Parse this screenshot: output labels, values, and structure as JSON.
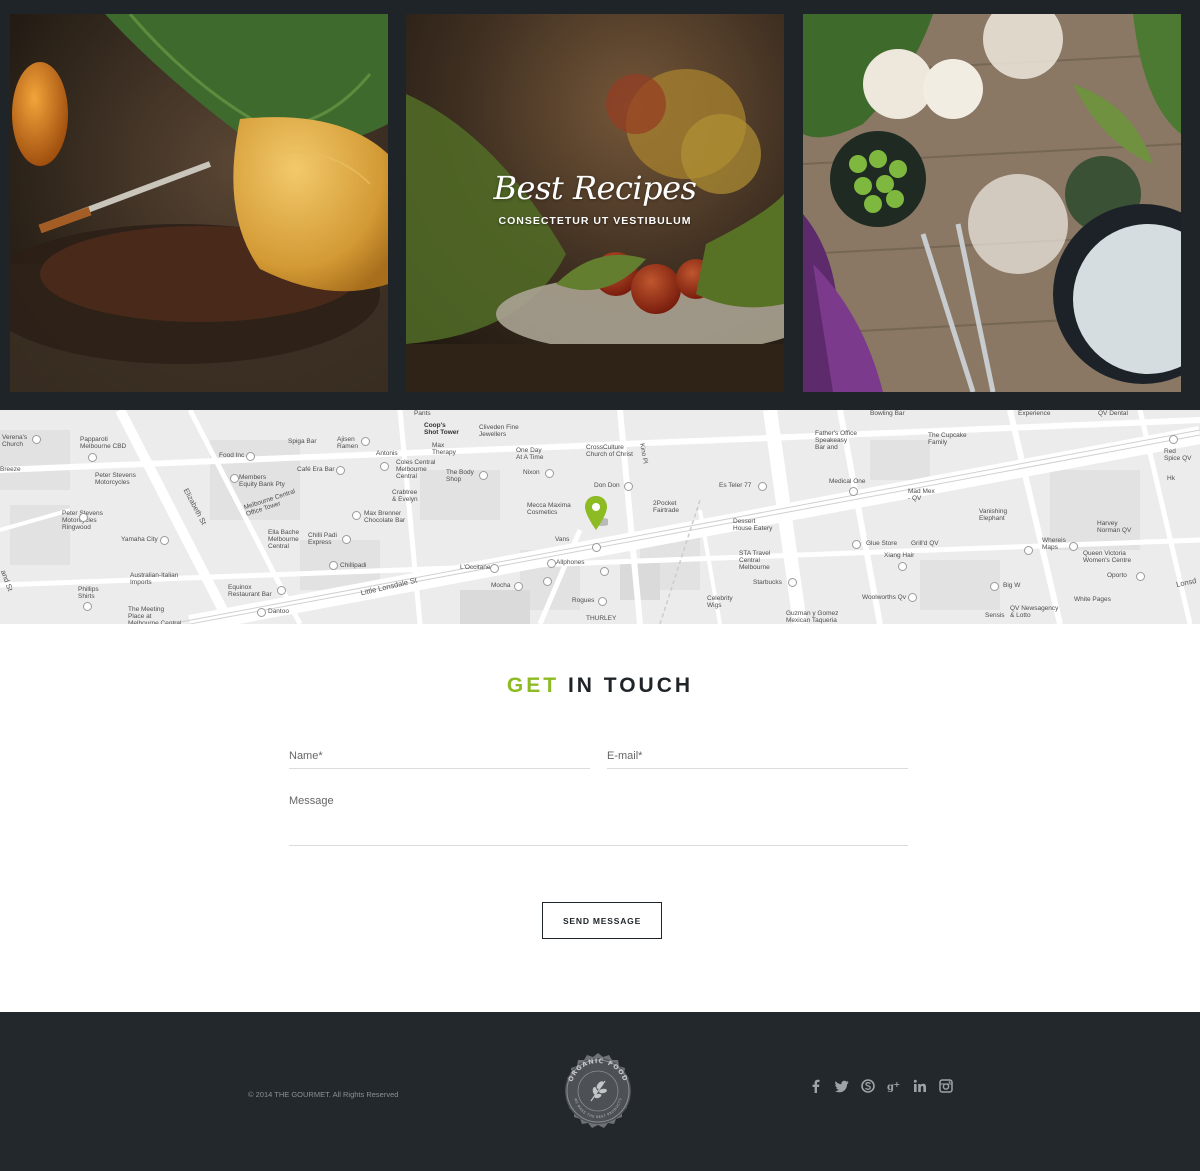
{
  "gallery": {
    "tiles": [
      {
        "name": "dessert-plate-photo"
      },
      {
        "name": "tomato-basil-photo",
        "title": "Best Recipes",
        "subtitle": "CONSECTETUR UT VESTIBULUM"
      },
      {
        "name": "table-setting-photo"
      }
    ]
  },
  "map": {
    "labels": [
      {
        "text": "Verena's\nChurch"
      },
      {
        "text": "Papparoti\nMelbourne CBD"
      },
      {
        "text": "Breeze"
      },
      {
        "text": "Peter Stevens\nMotorcycles"
      },
      {
        "text": "Peter Stevens\nMotorcycles\nRingwood"
      },
      {
        "text": "Yamaha City"
      },
      {
        "text": "Australian-Italian\nImports"
      },
      {
        "text": "Phillips\nShirts"
      },
      {
        "text": "The Meeting\nPlace at\nMelbourne Central"
      },
      {
        "text": "Food Inc"
      },
      {
        "text": "Members\nEquity Bank Pty"
      },
      {
        "text": "Melbourne Central\nOffice Tower"
      },
      {
        "text": "Ella Bache\nMelbourne\nCentral"
      },
      {
        "text": "Equinox\nRestaurant Bar"
      },
      {
        "text": "Dantoo"
      },
      {
        "text": "Spiga Bar"
      },
      {
        "text": "Café Era Bar"
      },
      {
        "text": "Ajisen\nRamen"
      },
      {
        "text": "Antonis"
      },
      {
        "text": "Chilli Padi\nExpress"
      },
      {
        "text": "Chillipadi"
      },
      {
        "text": "Max Brenner\nChocolate Bar"
      },
      {
        "text": "Coles Central\nMelbourne\nCentral"
      },
      {
        "text": "Crabtree\n& Evelyn"
      },
      {
        "text": "Max\nTherapy"
      },
      {
        "text": "Coop's\nShot Tower",
        "bold": true
      },
      {
        "text": "Cliveden Fine\nJewellers"
      },
      {
        "text": "The Body\nShop"
      },
      {
        "text": "One Day\nAt A Time"
      },
      {
        "text": "Nixon"
      },
      {
        "text": "Mecca Maxima\nCosmetics"
      },
      {
        "text": "L'Occitane"
      },
      {
        "text": "Mocha"
      },
      {
        "text": "Vans"
      },
      {
        "text": "Allphones"
      },
      {
        "text": "Rogues"
      },
      {
        "text": "THURLEY"
      },
      {
        "text": "CrossCulture\nChurch of Christ"
      },
      {
        "text": "Don Don"
      },
      {
        "text": "2Pocket\nFairtrade"
      },
      {
        "text": "Es Teler 77"
      },
      {
        "text": "Dessert\nHouse Eatery"
      },
      {
        "text": "STA Travel\nCentral\nMelbourne"
      },
      {
        "text": "Starbucks"
      },
      {
        "text": "Celebrity\nWigs"
      },
      {
        "text": "Guzman y Gomez\nMexican Taqueria"
      },
      {
        "text": "Father's Office\nSpeakeasy\nBar and"
      },
      {
        "text": "Bowling Bar"
      },
      {
        "text": "Medical One"
      },
      {
        "text": "Mad Mex\n- QV"
      },
      {
        "text": "The Cupcake\nFamily"
      },
      {
        "text": "Glue Store"
      },
      {
        "text": "Xiang Hair"
      },
      {
        "text": "Grill'd QV"
      },
      {
        "text": "Woolworths Qv"
      },
      {
        "text": "Vanishing\nElephant"
      },
      {
        "text": "Big W"
      },
      {
        "text": "QV Newsagency\n& Lotto"
      },
      {
        "text": "Sensis"
      },
      {
        "text": "Whereis\nMaps"
      },
      {
        "text": "Harvey\nNorman QV"
      },
      {
        "text": "Queen Victoria\nWomen's Centre"
      },
      {
        "text": "Oporto"
      },
      {
        "text": "White Pages"
      },
      {
        "text": "Red\nSpice QV"
      },
      {
        "text": "Experience"
      },
      {
        "text": "QV Dental"
      },
      {
        "text": "Pants"
      },
      {
        "text": "Kino Pl"
      },
      {
        "text": "Hk"
      }
    ],
    "streets": [
      {
        "text": "Elizabeth St"
      },
      {
        "text": "Little Lonsdale St"
      },
      {
        "text": "Lonsd"
      },
      {
        "text": "and St"
      }
    ],
    "numbers": [
      "379",
      "329",
      "24",
      "260",
      "265",
      "273",
      "277",
      "283",
      "5-7",
      "17-19",
      "13-15",
      "31-33",
      "30-32",
      "305-307",
      "193",
      "150",
      "14-16",
      "26"
    ]
  },
  "contact": {
    "title_accent": "GET",
    "title_rest": "IN TOUCH",
    "name_placeholder": "Name*",
    "email_placeholder": "E-mail*",
    "message_placeholder": "Message",
    "send_label": "SEND MESSAGE"
  },
  "footer": {
    "copyright": "© 2014 THE GOURMET. All Rights Reserved",
    "badge_top_text": "ORGANIC FOOD",
    "badge_bottom_text": "WE MAKE THE BEST PRODUCTS",
    "social": [
      "facebook-icon",
      "twitter-icon",
      "skype-icon",
      "google-plus-icon",
      "linkedin-icon",
      "instagram-icon"
    ]
  },
  "colors": {
    "accent": "#8dbb24",
    "dark": "#1f2429",
    "footer": "#23282d"
  }
}
